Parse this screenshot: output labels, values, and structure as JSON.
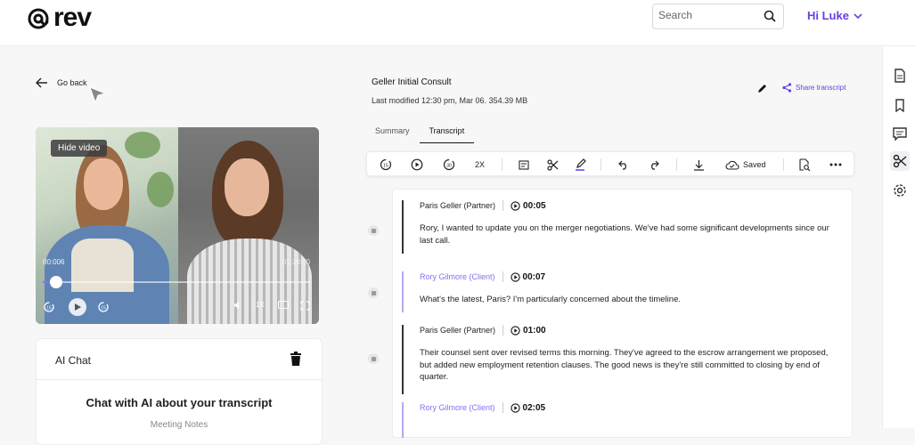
{
  "header": {
    "logo_text": "rev",
    "search_placeholder": "Search",
    "user_greeting": "Hi Luke"
  },
  "nav": {
    "go_back": "Go back"
  },
  "video": {
    "hide_label": "Hide video",
    "current_time": "00:006",
    "duration": "01:30:00",
    "progress": 0.05,
    "speed": "1X"
  },
  "ai_chat": {
    "title": "AI Chat",
    "heading": "Chat with AI about your transcript",
    "sub": "Meeting Notes"
  },
  "document": {
    "title": "Geller Initial Consult",
    "meta": "Last modified 12:30 pm, Mar 06. 354.39 MB",
    "share_label": "Share transcript",
    "tabs": [
      "Summary",
      "Transcript"
    ],
    "active_tab": "Transcript"
  },
  "toolbar": {
    "speed_label": "2X",
    "saved_label": "Saved"
  },
  "transcript": [
    {
      "speaker": "Paris Geller (Partner)",
      "time": "00:05",
      "role": "partner",
      "text": "Rory, I wanted to update you on the merger negotiations. We've had some significant developments since our last call."
    },
    {
      "speaker": "Rory Gilmore (Client)",
      "time": "00:07",
      "role": "client",
      "text": "What's the latest, Paris? I'm particularly concerned about the timeline."
    },
    {
      "speaker": "Paris Geller (Partner)",
      "time": "01:00",
      "role": "partner",
      "text": "Their counsel sent over revised terms this morning. They've agreed to the escrow arrangement we proposed, but added new employment retention clauses. The good news is they're still committed to closing by end of quarter."
    },
    {
      "speaker": "Rory Gilmore (Client)",
      "time": "02:05",
      "role": "client",
      "text": ""
    }
  ],
  "colors": {
    "accent": "#6a3ee0",
    "client_speaker": "#8a6df0"
  }
}
